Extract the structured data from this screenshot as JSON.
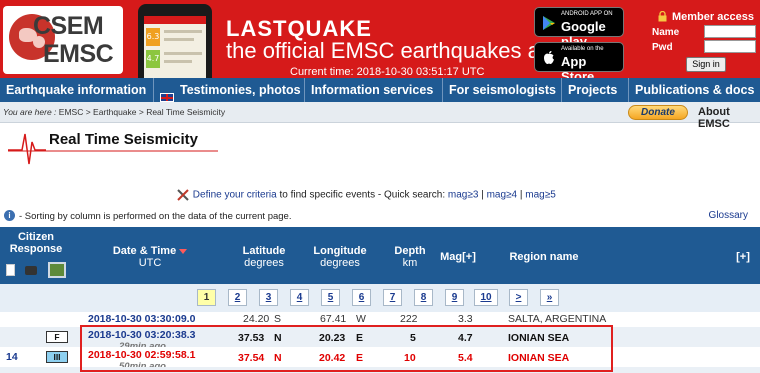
{
  "header": {
    "logo": {
      "line1": "CSEM",
      "line2": "EMSC"
    },
    "app_title": "LASTQUAKE",
    "app_subtitle": "the official EMSC earthquakes app",
    "current_time": "Current time: 2018-10-30 03:51:17 UTC",
    "google_play": {
      "small": "ANDROID APP ON",
      "big": "Google play"
    },
    "app_store": {
      "small": "Available on the",
      "big": "App Store"
    },
    "member": {
      "title": "Member access",
      "name_label": "Name",
      "pwd_label": "Pwd",
      "name_value": "",
      "pwd_value": "",
      "signin": "Sign in"
    },
    "phone_badges": [
      "6.3",
      "4.7"
    ]
  },
  "nav": {
    "items": [
      "Earthquake information",
      "Testimonies, photos",
      "Information services",
      "For seismologists",
      "Projects",
      "Publications & docs"
    ]
  },
  "breadcrumb": {
    "prefix": "You are here :",
    "path": "EMSC > Earthquake > Real Time Seismicity",
    "donate": "Donate",
    "about": "About EMSC"
  },
  "page_title": "Real Time Seismicity",
  "criteria": {
    "link": "Define your criteria",
    "text": "to find specific events - Quick search:",
    "links": [
      "mag≥3",
      "mag≥4",
      "mag≥5"
    ],
    "sep": "|"
  },
  "info": {
    "note": "- Sorting by column is performed on the data of the current page.",
    "glossary": "Glossary"
  },
  "table": {
    "headers": {
      "citizen": "Citizen",
      "response": "Response",
      "datetime": "Date & Time",
      "datetime_unit": "UTC",
      "lat": "Latitude",
      "lat_unit": "degrees",
      "lon": "Longitude",
      "lon_unit": "degrees",
      "depth": "Depth",
      "depth_unit": "km",
      "mag": "Mag[+]",
      "region": "Region name",
      "plus": "[+]"
    },
    "pages": [
      "1",
      "2",
      "3",
      "4",
      "5",
      "6",
      "7",
      "8",
      "9",
      "10",
      ">",
      "»"
    ],
    "current_page": "1",
    "rows": [
      {
        "count": "",
        "badge": "",
        "datetime": "2018-10-30   03:30:09.0",
        "ago": "",
        "lat": "24.20",
        "lat_dir": "S",
        "lon": "67.41",
        "lon_dir": "W",
        "depth": "222",
        "mag": "3.3",
        "region": "SALTA, ARGENTINA"
      },
      {
        "count": "",
        "badge": "F",
        "datetime": "2018-10-30   03:20:38.3",
        "ago": "29min ago",
        "lat": "37.53",
        "lat_dir": "N",
        "lon": "20.23",
        "lon_dir": "E",
        "depth": "5",
        "mag": "4.7",
        "region": "IONIAN SEA"
      },
      {
        "count": "14",
        "badge": "III",
        "datetime": "2018-10-30   02:59:58.1",
        "ago": "50min ago",
        "lat": "37.54",
        "lat_dir": "N",
        "lon": "20.42",
        "lon_dir": "E",
        "depth": "10",
        "mag": "5.4",
        "region": "IONIAN SEA"
      }
    ]
  },
  "colors": {
    "brand_red": "#d61a1a",
    "nav_blue": "#1f5a93",
    "highlight_red": "#e0201f",
    "link_blue": "#1a3a8f"
  }
}
